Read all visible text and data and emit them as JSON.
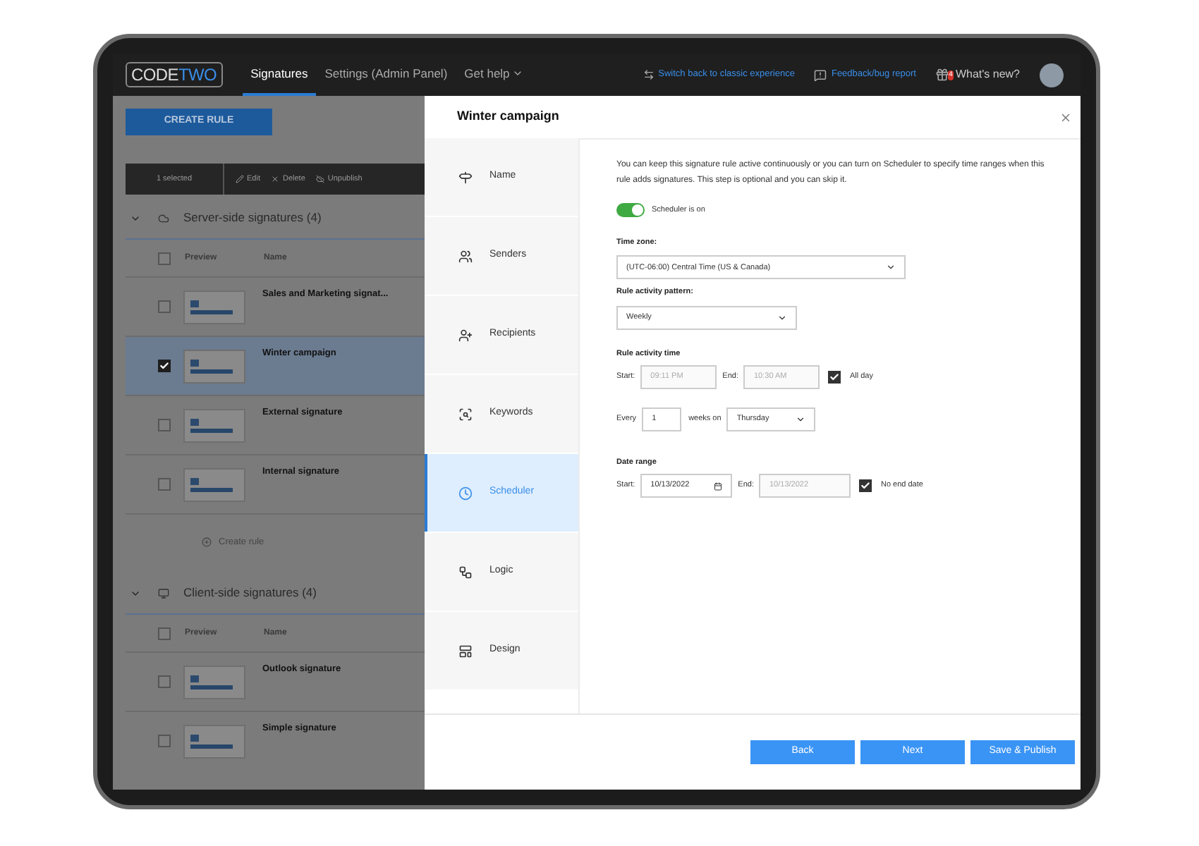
{
  "top_bar": {
    "logo": {
      "part_1": "CODE",
      "part_2": "TWO"
    },
    "tabs": [
      {
        "label": "Signatures",
        "selected": true
      },
      {
        "label": "Settings (Admin Panel)",
        "selected": false
      },
      {
        "label": "Get help",
        "selected": false
      }
    ],
    "links": [
      "Switch back to classic experience",
      "Feedback/bug report"
    ],
    "whats_new": {
      "label": "What's new?",
      "badge": "4"
    }
  },
  "rules_panel": {
    "create_button": "CREATE RULE",
    "toolbar": {
      "selected_count": "1 selected",
      "actions": [
        "Edit",
        "Delete",
        "Unpublish"
      ]
    },
    "groups": [
      {
        "title": "Server-side signatures (4)",
        "expanded": true,
        "all_checked": false,
        "columns": [
          "Preview",
          "Name"
        ],
        "rows": [
          {
            "name": "Sales and Marketing signat...",
            "checked": false,
            "selected": false
          },
          {
            "name": "Winter campaign",
            "checked": true,
            "selected": true
          },
          {
            "name": "External signature",
            "checked": false,
            "selected": false
          },
          {
            "name": "Internal signature",
            "checked": false,
            "selected": false
          }
        ],
        "create_rule": "Create rule"
      },
      {
        "title": "Client-side signatures (4)",
        "expanded": true,
        "all_checked": false,
        "columns": [
          "Preview",
          "Name"
        ],
        "rows": [
          {
            "name": "Outlook signature",
            "checked": false,
            "selected": false
          },
          {
            "name": "Simple signature",
            "checked": false,
            "selected": false
          }
        ]
      }
    ]
  },
  "dialog": {
    "title": "Winter campaign",
    "steps": [
      {
        "label": "Name",
        "selected": false
      },
      {
        "label": "Senders",
        "selected": false
      },
      {
        "label": "Recipients",
        "selected": false
      },
      {
        "label": "Keywords",
        "selected": false
      },
      {
        "label": "Scheduler",
        "selected": true
      },
      {
        "label": "Logic",
        "selected": false
      },
      {
        "label": "Design",
        "selected": false
      }
    ],
    "description": "You can keep this signature rule active continuously or you can turn on Scheduler to specify time ranges when this rule adds signatures. This step is optional and you can skip it.",
    "scheduler": {
      "label": "Scheduler is on",
      "on": true
    },
    "time_zone": {
      "label": "Time zone:",
      "value": "(UTC-06:00) Central Time (US & Canada)"
    },
    "pattern": {
      "label": "Rule activity pattern:",
      "value": "Weekly"
    },
    "activity_time": {
      "label": "Rule activity time",
      "start_label": "Start:",
      "start_value": "09:11 PM",
      "end_label": "End:",
      "end_value": "10:30 AM",
      "all_day": {
        "label": "All day",
        "checked": true
      }
    },
    "recurrence": {
      "label": "Every",
      "value": "1",
      "unit_label": "weeks on",
      "day": "Thursday"
    },
    "date_range": {
      "label": "Date range",
      "start_label": "Start:",
      "start_value": "10/13/2022",
      "end_label": "End:",
      "end_value": "10/13/2022",
      "no_end_date": {
        "label": "No end date",
        "checked": true
      }
    },
    "buttons": [
      "Back",
      "Next",
      "Save & Publish"
    ]
  }
}
